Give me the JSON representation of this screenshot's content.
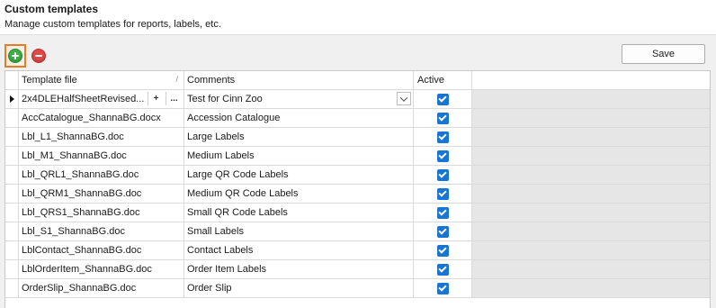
{
  "header": {
    "title": "Custom templates",
    "subtitle": "Manage custom templates for reports, labels, etc."
  },
  "toolbar": {
    "add_icon": "plus-circle-icon",
    "remove_icon": "minus-circle-icon",
    "save_label": "Save"
  },
  "grid": {
    "columns": [
      "Template file",
      "Comments",
      "Active"
    ],
    "rows": [
      {
        "file": "2x4DLEHalfSheetRevised...",
        "comment": "Test for Cinn Zoo",
        "active": true
      },
      {
        "file": "AccCatalogue_ShannaBG.docx",
        "comment": "Accession Catalogue",
        "active": true
      },
      {
        "file": "Lbl_L1_ShannaBG.doc",
        "comment": "Large Labels",
        "active": true
      },
      {
        "file": "Lbl_M1_ShannaBG.doc",
        "comment": "Medium Labels",
        "active": true
      },
      {
        "file": "Lbl_QRL1_ShannaBG.doc",
        "comment": "Large QR Code Labels",
        "active": true
      },
      {
        "file": "Lbl_QRM1_ShannaBG.doc",
        "comment": "Medium QR Code Labels",
        "active": true
      },
      {
        "file": "Lbl_QRS1_ShannaBG.doc",
        "comment": "Small QR Code Labels",
        "active": true
      },
      {
        "file": "Lbl_S1_ShannaBG.doc",
        "comment": "Small Labels",
        "active": true
      },
      {
        "file": "LblContact_ShannaBG.doc",
        "comment": "Contact Labels",
        "active": true
      },
      {
        "file": "LblOrderItem_ShannaBG.doc",
        "comment": "Order Item Labels",
        "active": true
      },
      {
        "file": "OrderSlip_ShannaBG.doc",
        "comment": "Order Slip",
        "active": true
      }
    ],
    "current_row_buttons": [
      "+",
      "..."
    ]
  },
  "colors": {
    "accent_highlight": "#e47e26",
    "checkbox": "#1875d3",
    "add": "#3fae49",
    "remove": "#e04848"
  }
}
